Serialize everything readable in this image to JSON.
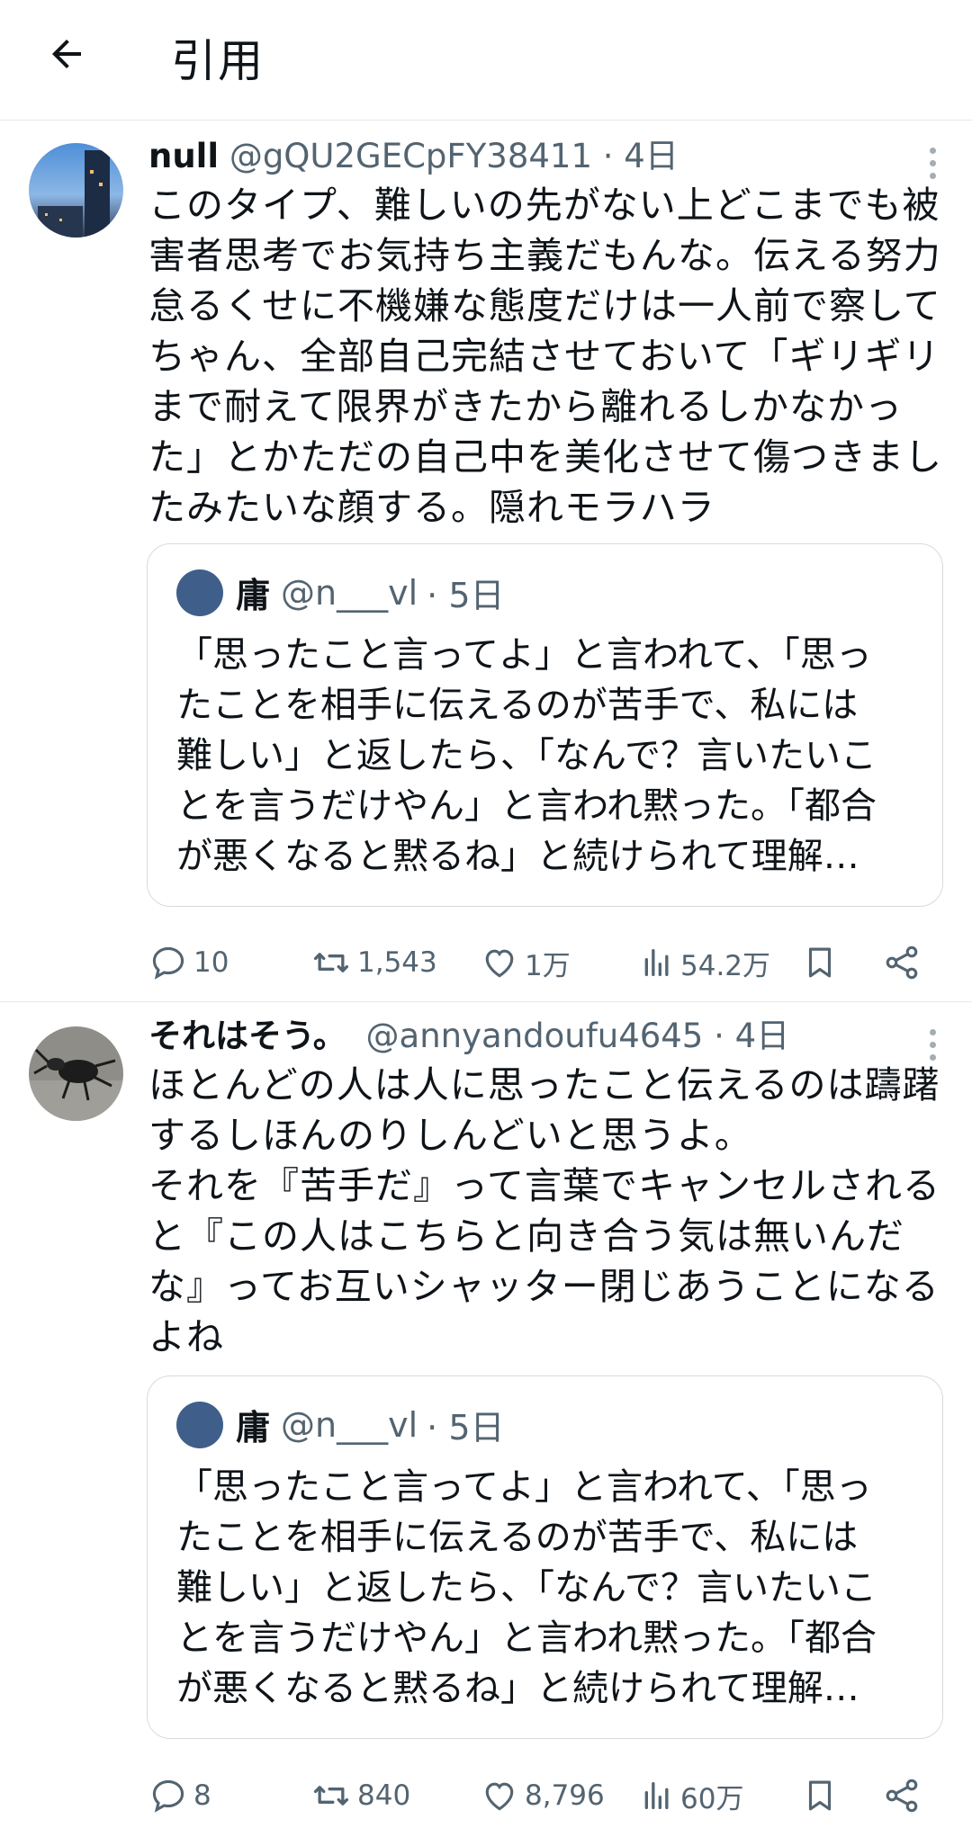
{
  "header": {
    "back_icon": "arrow-left-icon",
    "title": "引用"
  },
  "tweets": [
    {
      "name": "null",
      "handle": "@gQU2GECpFY38411",
      "time": "· 4日",
      "lines": [
        "このタイプ、難しいの先がない上どこまでも被",
        "害者思考でお気持ち主義だもんな。伝える努力",
        "怠るくせに不機嫌な態度だけは一人前で察して",
        "ちゃん、全部自己完結させておいて「ギリギリ",
        "まで耐えて限界がきたから離れるしかなかっ",
        "た」とかただの自己中を美化させて傷つきまし",
        "たみたいな顔する。隠れモラハラ"
      ],
      "quote": {
        "name": "庸",
        "handle": "@n___vl",
        "time": "· 5日",
        "lines": [
          "「思ったこと言ってよ」と言われて、「思っ",
          "たことを相手に伝えるのが苦手で、私には",
          "難しい」と返したら、「なんで？言いたいこ",
          "とを言うだけやん」と言われ黙った。「都合",
          "が悪くなると黙るね」と続けられて理解…"
        ]
      },
      "stats": {
        "replies": "10",
        "retweets": "1,543",
        "likes": "1万",
        "views": "54.2万"
      }
    },
    {
      "name": "それはそう。",
      "handle": "@annyandoufu4645",
      "time": "· 4日",
      "lines": [
        "ほとんどの人は人に思ったこと伝えるのは躊躇",
        "するしほんのりしんどいと思うよ。",
        "それを『苦手だ』って言葉でキャンセルされる",
        "と『この人はこちらと向き合う気は無いんだ",
        "な』ってお互いシャッター閉じあうことになる",
        "よね"
      ],
      "quote": {
        "name": "庸",
        "handle": "@n___vl",
        "time": "· 5日",
        "lines": [
          "「思ったこと言ってよ」と言われて、「思っ",
          "たことを相手に伝えるのが苦手で、私には",
          "難しい」と返したら、「なんで？言いたいこ",
          "とを言うだけやん」と言われ黙った。「都合",
          "が悪くなると黙るね」と続けられて理解…"
        ]
      },
      "stats": {
        "replies": "8",
        "retweets": "840",
        "likes": "8,796",
        "views": "60万"
      }
    }
  ],
  "colors": {
    "text": "#0f1419",
    "secondary": "#536471",
    "border": "#d6dbdf"
  }
}
